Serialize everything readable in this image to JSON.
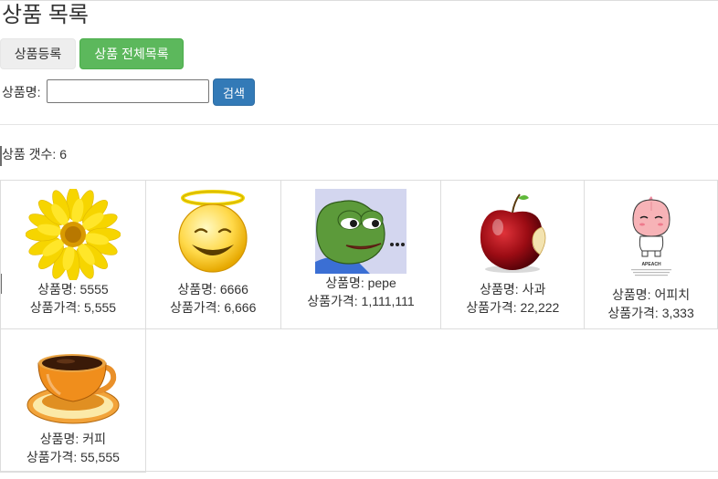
{
  "header": {
    "title": "상품 목록"
  },
  "toolbar": {
    "register_label": "상품등록",
    "all_label": "상품 전체목록"
  },
  "search": {
    "label": "상품명:",
    "value": "",
    "button_label": "검색"
  },
  "summary": {
    "count_text": "상품 갯수: 6"
  },
  "colors": {
    "success": "#5cb85c",
    "primary": "#337ab7"
  },
  "products": [
    {
      "image": "sunflower-image",
      "name_text": "상품명: 5555",
      "price_text": "상품가격: 5,555"
    },
    {
      "image": "angel-smiley-image",
      "name_text": "상품명: 6666",
      "price_text": "상품가격: 6,666"
    },
    {
      "image": "pepe-frog-image",
      "name_text": "상품명: pepe",
      "price_text": "상품가격: 1,111,111"
    },
    {
      "image": "apple-image",
      "name_text": "상품명: 사과",
      "price_text": "상품가격: 22,222"
    },
    {
      "image": "apeach-image",
      "name_text": "상품명: 어피치",
      "price_text": "상품가격: 3,333",
      "image_caption": "APEACH"
    },
    {
      "image": "coffee-cup-image",
      "name_text": "상품명: 커피",
      "price_text": "상품가격: 55,555"
    }
  ]
}
